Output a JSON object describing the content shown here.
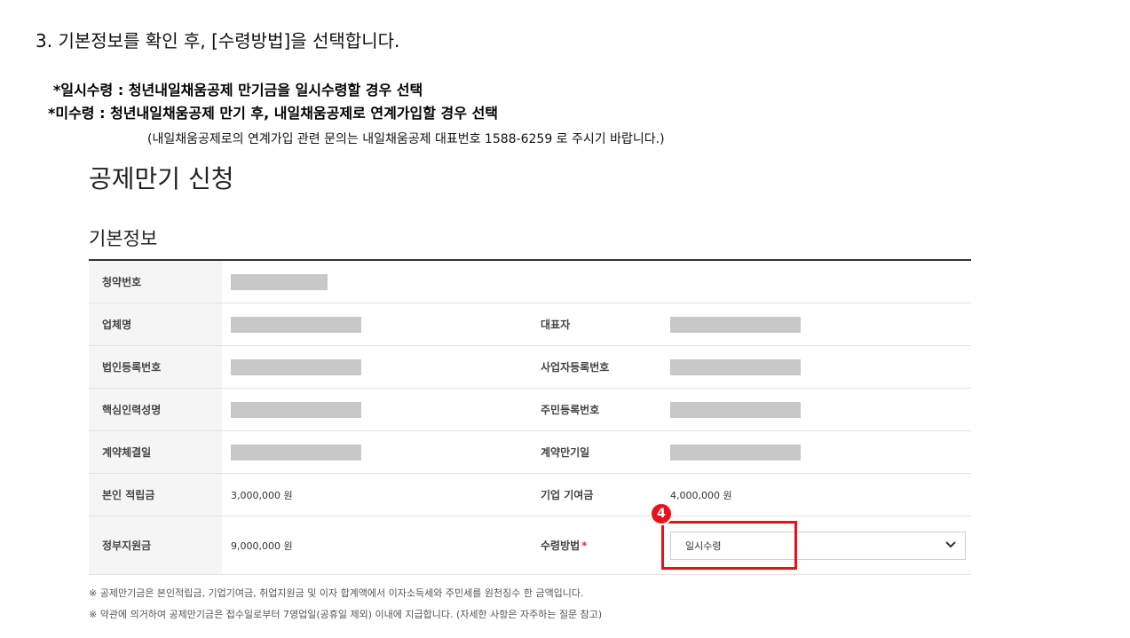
{
  "instructions": {
    "step": "3. 기본정보를 확인 후, [수령방법]을 선택합니다.",
    "note1": "*일시수령 : 청년내일채움공제 만기금을 일시수령할 경우 선택",
    "note2": "*미수령 : 청년내일채움공제 만기 후, 내일채움공제로 연계가입할 경우 선택",
    "note_sub": "(내일채움공제로의 연계가입 관련 문의는 내일채움공제 대표번호 1588-6259 로 주시기 바랍니다.)"
  },
  "page_title": "공제만기 신청",
  "section_title": "기본정보",
  "rows": {
    "subscription_no": {
      "label": "청약번호"
    },
    "company_name": {
      "label": "업체명"
    },
    "representative": {
      "label": "대표자"
    },
    "corp_reg_no": {
      "label": "법인등록번호"
    },
    "biz_reg_no": {
      "label": "사업자등록번호"
    },
    "core_person_name": {
      "label": "핵심인력성명"
    },
    "resident_reg_no": {
      "label": "주민등록번호"
    },
    "contract_date": {
      "label": "계약체결일"
    },
    "maturity_date": {
      "label": "계약만기일"
    },
    "personal_savings": {
      "label": "본인 적립금",
      "value": "3,000,000 원"
    },
    "company_contribution": {
      "label": "기업 기여금",
      "value": "4,000,000 원"
    },
    "gov_support": {
      "label": "정부지원금",
      "value": "9,000,000 원"
    },
    "receive_method": {
      "label": "수령방법",
      "required_mark": "*",
      "selected": "일시수령"
    }
  },
  "step_badge": "4",
  "footnotes": [
    "※ 공제만기금은 본인적립금, 기업기여금, 취업지원금 및 이자 합계액에서 이자소득세와 주민세를 원천징수 한 금액입니다.",
    "※ 약관에 의거하여 공제만기금은 접수일로부터 7영업일(공휴일 제외) 이내에 지급합니다. (자세한 사항은 자주하는 질문 참고)"
  ],
  "colors": {
    "highlight": "#e8111a",
    "label_bg": "#f5f5f5",
    "redacted": "#c8c8c8"
  },
  "icons": {
    "select_arrow": "chevron-down-icon"
  }
}
